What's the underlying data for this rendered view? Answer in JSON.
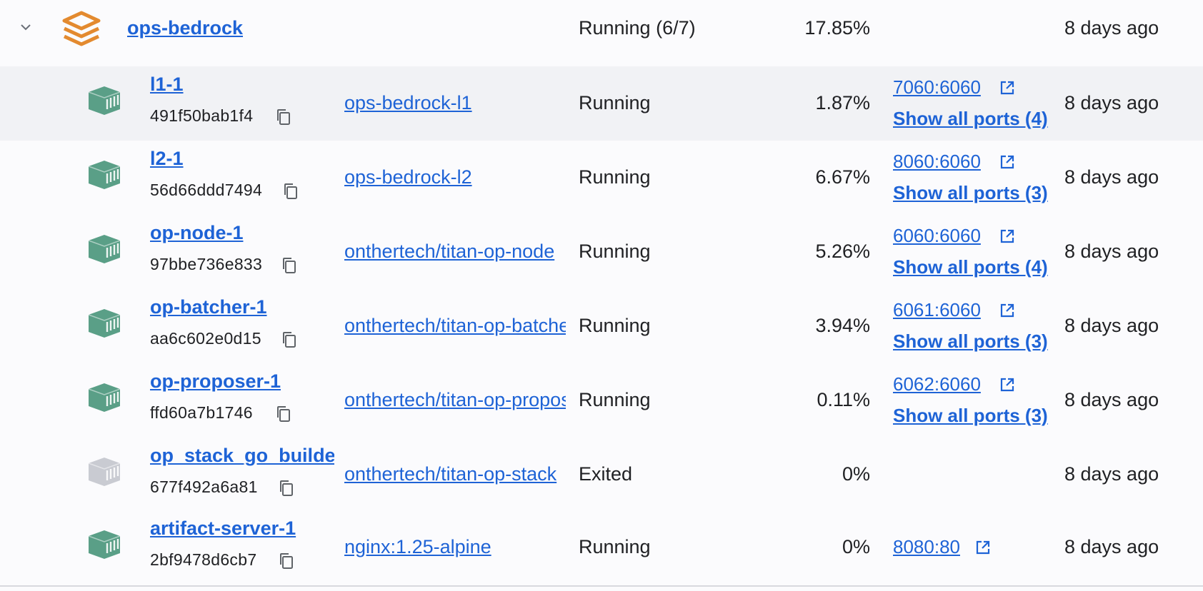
{
  "group": {
    "name": "ops-bedrock",
    "status": "Running (6/7)",
    "cpu": "17.85%",
    "last_started": "8 days ago",
    "icon": "stack-icon",
    "icon_color": "#e38a2f"
  },
  "containers": [
    {
      "name": "l1-1",
      "id": "491f50bab1f4",
      "image": "ops-bedrock-l1",
      "status": "Running",
      "cpu": "1.87%",
      "port": "7060:6060",
      "show_all": "Show all ports (4)",
      "last_started": "8 days ago",
      "state": "running"
    },
    {
      "name": "l2-1",
      "id": "56d66ddd7494",
      "image": "ops-bedrock-l2",
      "status": "Running",
      "cpu": "6.67%",
      "port": "8060:6060",
      "show_all": "Show all ports (3)",
      "last_started": "8 days ago",
      "state": "running"
    },
    {
      "name": "op-node-1",
      "id": "97bbe736e833",
      "image": "onthertech/titan-op-node",
      "status": "Running",
      "cpu": "5.26%",
      "port": "6060:6060",
      "show_all": "Show all ports (4)",
      "last_started": "8 days ago",
      "state": "running"
    },
    {
      "name": "op-batcher-1",
      "id": "aa6c602e0d15",
      "image": "onthertech/titan-op-batcher",
      "status": "Running",
      "cpu": "3.94%",
      "port": "6061:6060",
      "show_all": "Show all ports (3)",
      "last_started": "8 days ago",
      "state": "running"
    },
    {
      "name": "op-proposer-1",
      "id": "ffd60a7b1746",
      "image": "onthertech/titan-op-proposer",
      "status": "Running",
      "cpu": "0.11%",
      "port": "6062:6060",
      "show_all": "Show all ports (3)",
      "last_started": "8 days ago",
      "state": "running"
    },
    {
      "name": "op_stack_go_builder",
      "id": "677f492a6a81",
      "image": "onthertech/titan-op-stack",
      "status": "Exited",
      "cpu": "0%",
      "port": "",
      "show_all": "",
      "last_started": "8 days ago",
      "state": "exited"
    },
    {
      "name": "artifact-server-1",
      "id": "2bf9478d6cb7",
      "image": "nginx:1.25-alpine",
      "status": "Running",
      "cpu": "0%",
      "port": "8080:80",
      "show_all": "",
      "last_started": "8 days ago",
      "state": "running"
    }
  ],
  "colors": {
    "link": "#1e63d6",
    "running_icon": "#5a9f87",
    "exited_icon": "#c9cbd2",
    "hover_row": "#f1f2f5"
  }
}
